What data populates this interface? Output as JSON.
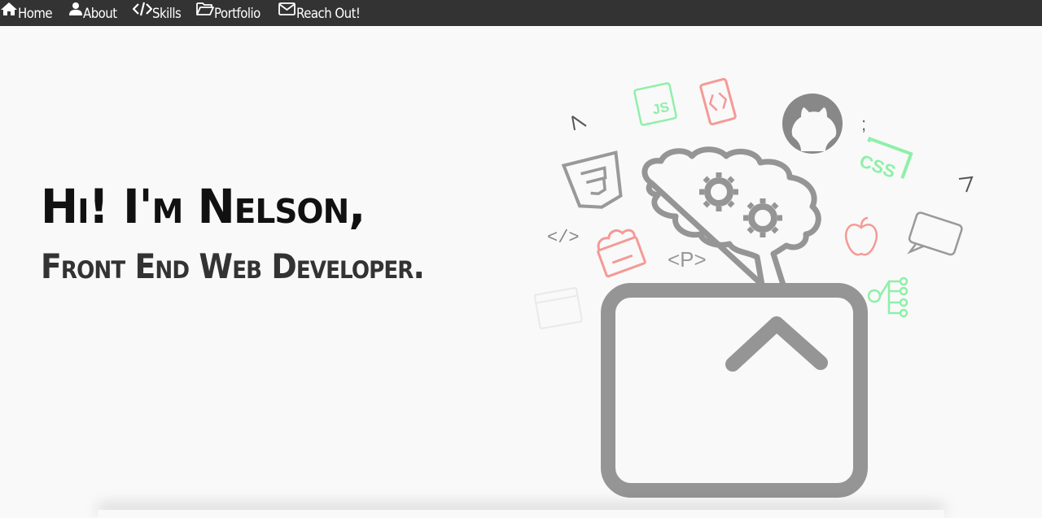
{
  "nav": {
    "items": [
      {
        "label": "Home",
        "icon": "home-icon"
      },
      {
        "label": "About",
        "icon": "user-icon"
      },
      {
        "label": "Skills",
        "icon": "code-icon"
      },
      {
        "label": "Portfolio",
        "icon": "folder-open-icon"
      },
      {
        "label": "Reach Out!",
        "icon": "envelope-icon"
      }
    ]
  },
  "hero": {
    "title": "Hi! I'm Nelson,",
    "subtitle": "Front End Web Developer."
  },
  "illustration": {
    "code_tag": "</>",
    "p_tag": "<P>",
    "js_label": "JS",
    "css_label": "CSS",
    "semicolon": ";"
  },
  "colors": {
    "nav_bg": "#333333",
    "page_bg": "#f9f9f9",
    "accent_green": "#8ef0a8",
    "accent_red": "#f49a96",
    "gray": "#959595"
  }
}
